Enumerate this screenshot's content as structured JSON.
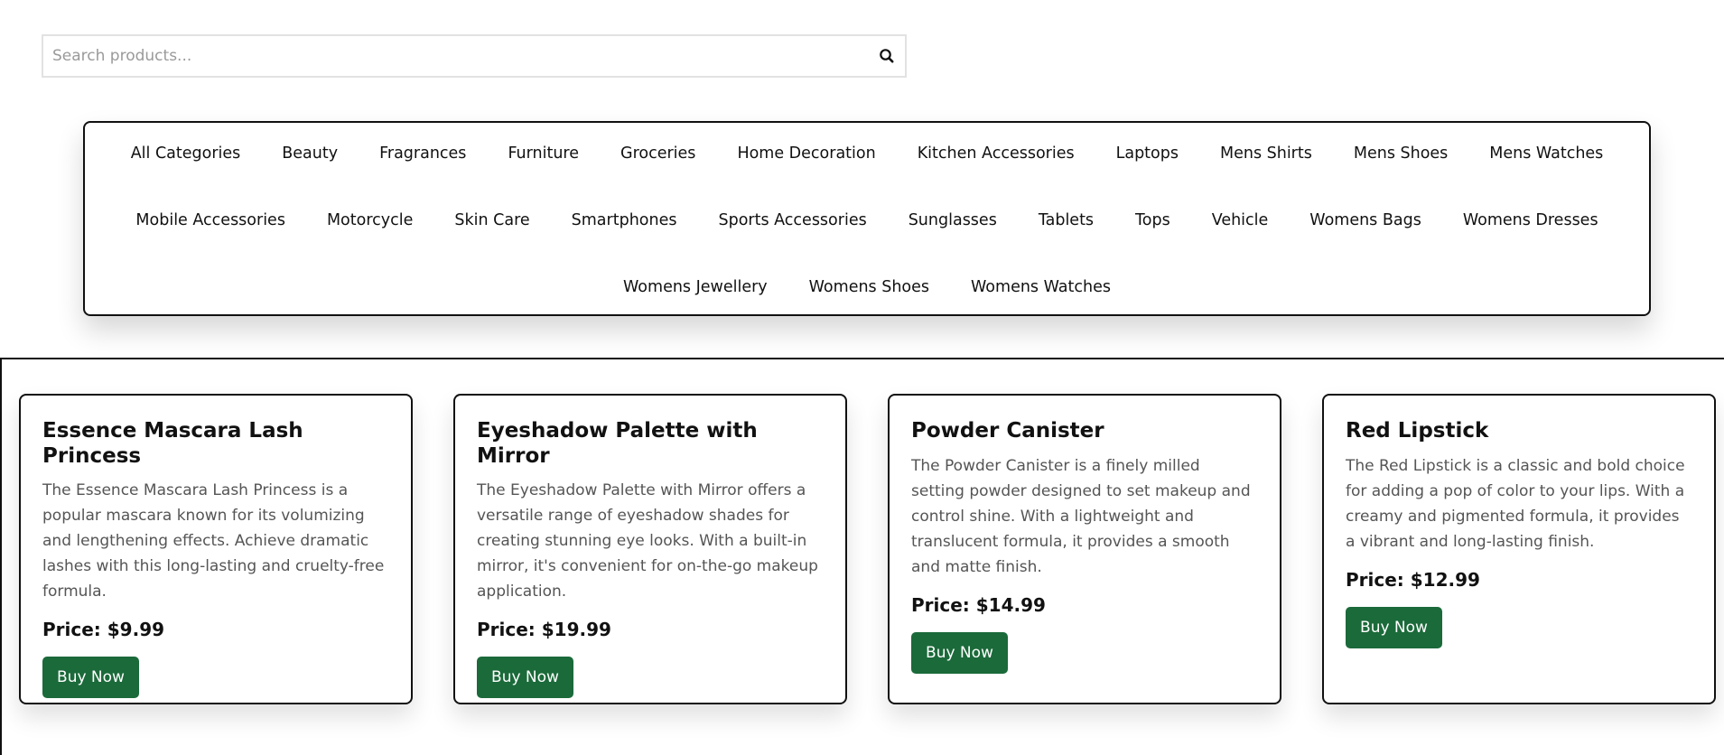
{
  "search": {
    "placeholder": "Search products..."
  },
  "categories": {
    "row1": [
      "All Categories",
      "Beauty",
      "Fragrances",
      "Furniture",
      "Groceries",
      "Home Decoration",
      "Kitchen Accessories",
      "Laptops",
      "Mens Shirts",
      "Mens Shoes",
      "Mens Watches"
    ],
    "row2": [
      "Mobile Accessories",
      "Motorcycle",
      "Skin Care",
      "Smartphones",
      "Sports Accessories",
      "Sunglasses",
      "Tablets",
      "Tops",
      "Vehicle",
      "Womens Bags",
      "Womens Dresses"
    ],
    "row3": [
      "Womens Jewellery",
      "Womens Shoes",
      "Womens Watches"
    ]
  },
  "products": [
    {
      "title": "Essence Mascara Lash Princess",
      "description": "The Essence Mascara Lash Princess is a popular mascara known for its volumizing and lengthening effects. Achieve dramatic lashes with this long-lasting and cruelty-free formula.",
      "price": "Price: $9.99",
      "button": "Buy Now"
    },
    {
      "title": "Eyeshadow Palette with Mirror",
      "description": "The Eyeshadow Palette with Mirror offers a versatile range of eyeshadow shades for creating stunning eye looks. With a built-in mirror, it's convenient for on-the-go makeup application.",
      "price": "Price: $19.99",
      "button": "Buy Now"
    },
    {
      "title": "Powder Canister",
      "description": "The Powder Canister is a finely milled setting powder designed to set makeup and control shine. With a lightweight and translucent formula, it provides a smooth and matte finish.",
      "price": "Price: $14.99",
      "button": "Buy Now"
    },
    {
      "title": "Red Lipstick",
      "description": "The Red Lipstick is a classic and bold choice for adding a pop of color to your lips. With a creamy and pigmented formula, it provides a vibrant and long-lasting finish.",
      "price": "Price: $12.99",
      "button": "Buy Now"
    }
  ],
  "colors": {
    "button_bg": "#1b6a3a",
    "border": "#111111"
  },
  "icons": {
    "search": "search-icon"
  }
}
